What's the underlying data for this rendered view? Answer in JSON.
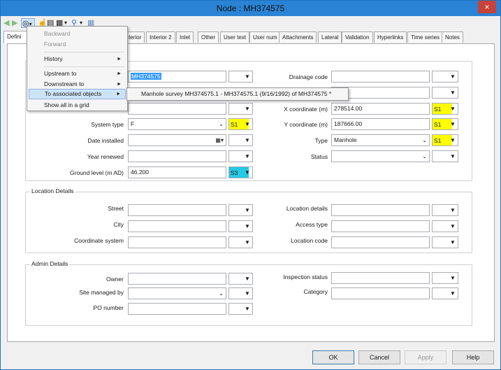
{
  "window": {
    "title": "Node : MH374575",
    "close_label": "×"
  },
  "toolbar": {
    "back_glyph": "◀",
    "forward_glyph": "▶",
    "nav_glyph": "◎",
    "dropdown_glyph": "▾",
    "pointer_glyph": "☝",
    "doc_glyph": "▤",
    "film_glyph": "▦",
    "share_glyph": "⚲",
    "grid_glyph": "▦"
  },
  "tabs": [
    "Defini",
    "terior",
    "Interior 2",
    "Inlet",
    "Other",
    "User text",
    "User num",
    "Attachments",
    "Lateral",
    "Validation",
    "Hyperlinks",
    "Time series",
    "Notes"
  ],
  "menu": {
    "items": [
      {
        "label": "Backward",
        "disabled": true
      },
      {
        "label": "Forward",
        "disabled": true
      },
      {
        "label": "History",
        "submenu": true
      },
      {
        "label": "Upstream to",
        "submenu": true
      },
      {
        "label": "Downstream to",
        "submenu": true
      },
      {
        "label": "To associated objects",
        "submenu": true,
        "hover": true
      },
      {
        "label": "Show all in a grid"
      }
    ],
    "submenu_arrow": "►",
    "submenu_item": "Manhole survey MH374575.1 - MH374575.1 (9/16/1992) of MH374575 *"
  },
  "general": {
    "node_id_value": "MH374575",
    "system_type_label": "System type",
    "system_type_value": "F",
    "system_type_flag": "S1",
    "date_installed_label": "Date installed",
    "year_renewed_label": "Year renewed",
    "ground_level_label": "Ground level (m AD)",
    "ground_level_value": "46.200",
    "ground_level_flag": "S3",
    "drainage_code_label": "Drainage code",
    "x_coord_label": "X coordinate (m)",
    "x_coord_value": "278514.00",
    "x_coord_flag": "S1",
    "y_coord_label": "Y coordinate (m)",
    "y_coord_value": "187666.00",
    "y_coord_flag": "S1",
    "type_label": "Type",
    "type_value": "Manhole",
    "type_flag": "S1",
    "status_label": "Status"
  },
  "location": {
    "title": "Location Details",
    "street_label": "Street",
    "city_label": "City",
    "coordinate_system_label": "Coordinate system",
    "location_details_label": "Location details",
    "access_type_label": "Access type",
    "location_code_label": "Location code"
  },
  "admin": {
    "title": "Admin Details",
    "owner_label": "Owner",
    "site_managed_label": "Site managed by",
    "po_number_label": "PO number",
    "inspection_status_label": "Inspection status",
    "category_label": "Category"
  },
  "buttons": {
    "ok": "OK",
    "cancel": "Cancel",
    "apply": "Apply",
    "help": "Help"
  },
  "colors": {
    "flag_yellow": "#ffff00",
    "flag_cyan": "#27c9e3",
    "title_bar": "#2a83d4"
  }
}
